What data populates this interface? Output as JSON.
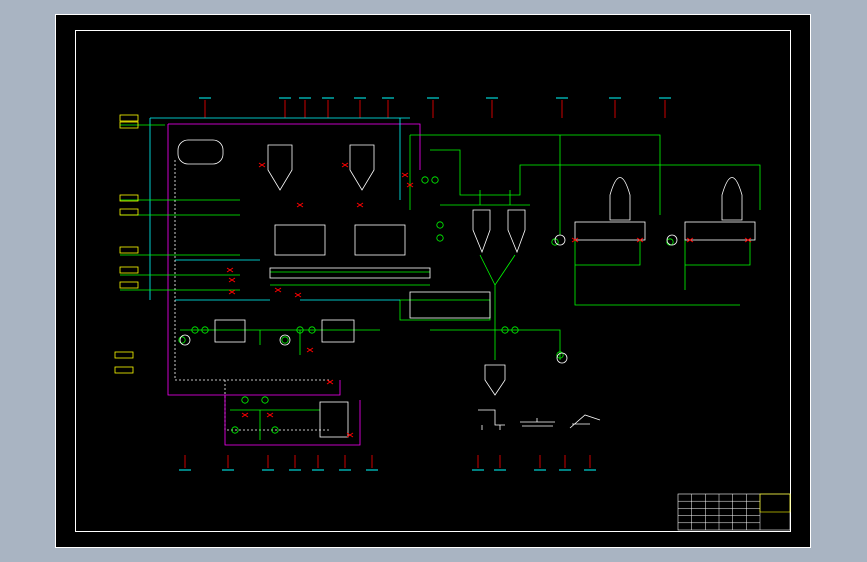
{
  "viewer": {
    "background_color": "#a9b4c2",
    "paper_color": "#000000"
  },
  "diagram": {
    "colors": {
      "process_line": "#00ff00",
      "steam_line": "#ff00ff",
      "water_line": "#00ffff",
      "equipment": "#ffffff",
      "valve": "#ff0000",
      "label": "#00ffff",
      "tag_yellow": "#ffff00"
    },
    "title_block": {
      "rows": 5,
      "columns": 6
    }
  }
}
